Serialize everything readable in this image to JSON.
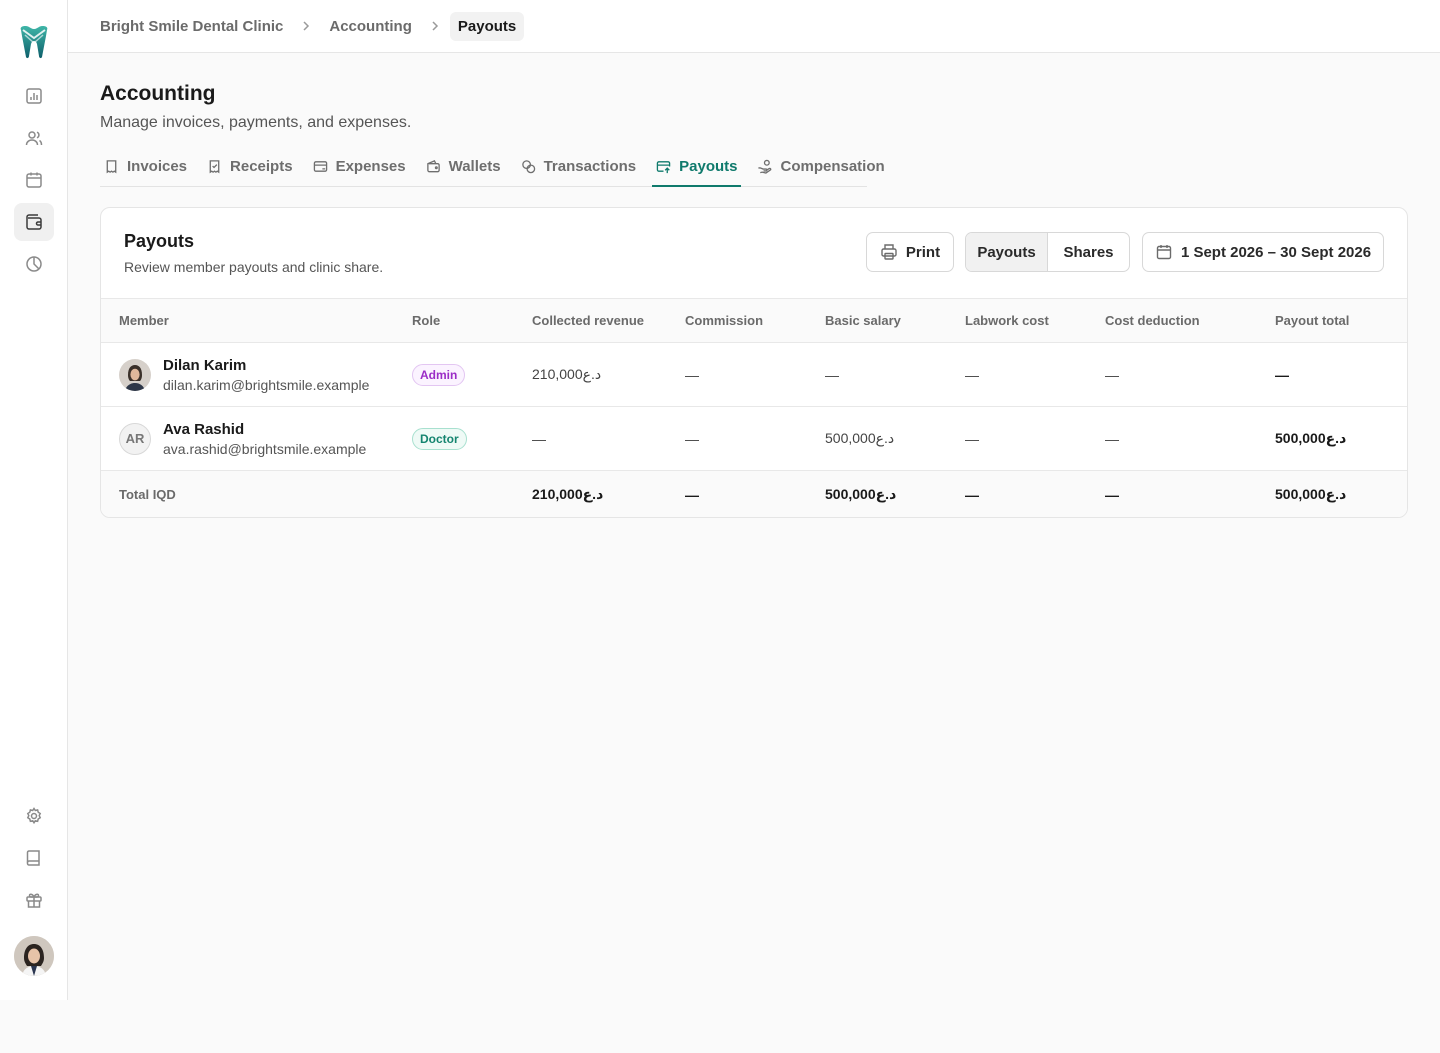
{
  "breadcrumb": [
    "Bright Smile Dental Clinic",
    "Accounting",
    "Payouts"
  ],
  "page": {
    "title": "Accounting",
    "subtitle": "Manage invoices, payments, and expenses."
  },
  "tabs": [
    {
      "label": "Invoices",
      "icon": "receipt-icon"
    },
    {
      "label": "Receipts",
      "icon": "receipt-check-icon"
    },
    {
      "label": "Expenses",
      "icon": "card-minus-icon"
    },
    {
      "label": "Wallets",
      "icon": "wallet-icon"
    },
    {
      "label": "Transactions",
      "icon": "coins-icon"
    },
    {
      "label": "Payouts",
      "icon": "card-upload-icon",
      "active": true
    },
    {
      "label": "Compensation",
      "icon": "hand-coins-icon"
    }
  ],
  "card": {
    "title": "Payouts",
    "subtitle": "Review member payouts and clinic share.",
    "print_label": "Print",
    "view_toggle": {
      "options": [
        "Payouts",
        "Shares"
      ],
      "selected": "Payouts"
    },
    "date_range": "1 Sept 2026 – 30 Sept 2026"
  },
  "table": {
    "columns": [
      "Member",
      "Role",
      "Collected revenue",
      "Commission",
      "Basic salary",
      "Labwork cost",
      "Cost deduction",
      "Payout total"
    ],
    "rows": [
      {
        "name": "Dilan Karim",
        "email": "dilan.karim@brightsmile.example",
        "avatar": "photo",
        "role": "Admin",
        "collected_revenue": "210,000د.ع",
        "commission": "—",
        "basic_salary": "—",
        "labwork_cost": "—",
        "cost_deduction": "—",
        "payout_total": "—"
      },
      {
        "name": "Ava Rashid",
        "email": "ava.rashid@brightsmile.example",
        "avatar": "AR",
        "role": "Doctor",
        "collected_revenue": "—",
        "commission": "—",
        "basic_salary": "500,000د.ع",
        "labwork_cost": "—",
        "cost_deduction": "—",
        "payout_total": "500,000د.ع"
      }
    ],
    "total": {
      "label": "Total IQD",
      "collected_revenue": "210,000د.ع",
      "commission": "—",
      "basic_salary": "500,000د.ع",
      "labwork_cost": "—",
      "cost_deduction": "—",
      "payout_total": "500,000د.ع"
    }
  },
  "colors": {
    "accent": "#0f7a6c",
    "admin_badge": "#9b2cc7",
    "doctor_badge": "#14846f"
  }
}
